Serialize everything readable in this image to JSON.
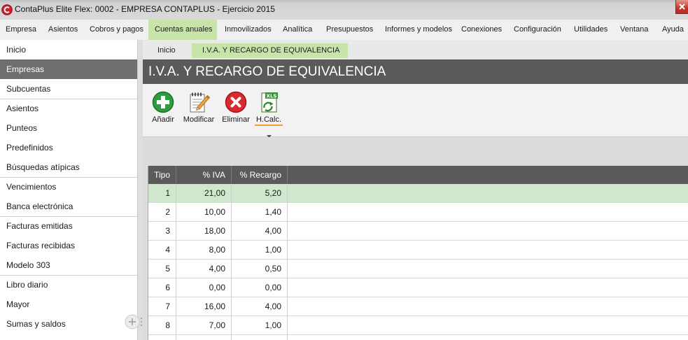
{
  "window": {
    "title": "ContaPlus Elite Flex: 0002 - EMPRESA CONTAPLUS - Ejercicio 2015",
    "icon": "contaplus-logo-icon"
  },
  "menu": {
    "items": [
      {
        "label": "Empresa"
      },
      {
        "label": "Asientos"
      },
      {
        "label": "Cobros y pagos"
      },
      {
        "label": "Cuentas anuales",
        "active": true
      },
      {
        "label": "Inmovilizados"
      },
      {
        "label": "Analítica"
      },
      {
        "label": "Presupuestos"
      },
      {
        "label": "Informes y modelos"
      },
      {
        "label": "Conexiones"
      },
      {
        "label": "Configuración"
      },
      {
        "label": "Utilidades"
      },
      {
        "label": "Ventana"
      },
      {
        "label": "Ayuda"
      }
    ]
  },
  "sidebar": {
    "items": [
      {
        "label": "Inicio"
      },
      {
        "label": "Empresas",
        "selected": true
      },
      {
        "label": "Subcuentas"
      },
      {
        "label": "Asientos"
      },
      {
        "label": "Punteos"
      },
      {
        "label": "Predefinidos"
      },
      {
        "label": "Búsquedas atípicas"
      },
      {
        "label": "Vencimientos"
      },
      {
        "label": "Banca electrónica"
      },
      {
        "label": "Facturas emitidas"
      },
      {
        "label": "Facturas recibidas"
      },
      {
        "label": "Modelo 303"
      },
      {
        "label": "Libro diario"
      },
      {
        "label": "Mayor"
      },
      {
        "label": "Sumas y saldos"
      }
    ],
    "add_button_icon": "plus-icon"
  },
  "tabs": [
    {
      "label": "Inicio"
    },
    {
      "label": "I.V.A. Y RECARGO DE EQUIVALENCIA",
      "active": true
    }
  ],
  "page": {
    "title": "I.V.A. Y RECARGO DE EQUIVALENCIA"
  },
  "toolbar": {
    "buttons": [
      {
        "label": "Añadir",
        "icon": "add-icon"
      },
      {
        "label": "Modificar",
        "icon": "edit-icon"
      },
      {
        "label": "Eliminar",
        "icon": "delete-icon"
      },
      {
        "label": "H.Calc.",
        "icon": "spreadsheet-xls-icon",
        "icon_text": "XLS",
        "has_dropdown": true
      }
    ]
  },
  "grid": {
    "columns": [
      "Tipo",
      "% IVA",
      "% Recargo"
    ],
    "rows": [
      {
        "tipo": "1",
        "iva": "21,00",
        "recargo": "5,20",
        "selected": true
      },
      {
        "tipo": "2",
        "iva": "10,00",
        "recargo": "1,40"
      },
      {
        "tipo": "3",
        "iva": "18,00",
        "recargo": "4,00"
      },
      {
        "tipo": "4",
        "iva": "8,00",
        "recargo": "1,00"
      },
      {
        "tipo": "5",
        "iva": "4,00",
        "recargo": "0,50"
      },
      {
        "tipo": "6",
        "iva": "0,00",
        "recargo": "0,00"
      },
      {
        "tipo": "7",
        "iva": "16,00",
        "recargo": "4,00"
      },
      {
        "tipo": "8",
        "iva": "7,00",
        "recargo": "1,00"
      }
    ]
  },
  "colors": {
    "active_green": "#c8e4a9",
    "selected_row": "#cfe8cd",
    "header_dark": "#5a5a5a",
    "sidebar_selected": "#6e6e6e",
    "add_green": "#2c9e3f",
    "delete_red": "#d92a2e",
    "dropdown_underline": "#f0a030"
  }
}
